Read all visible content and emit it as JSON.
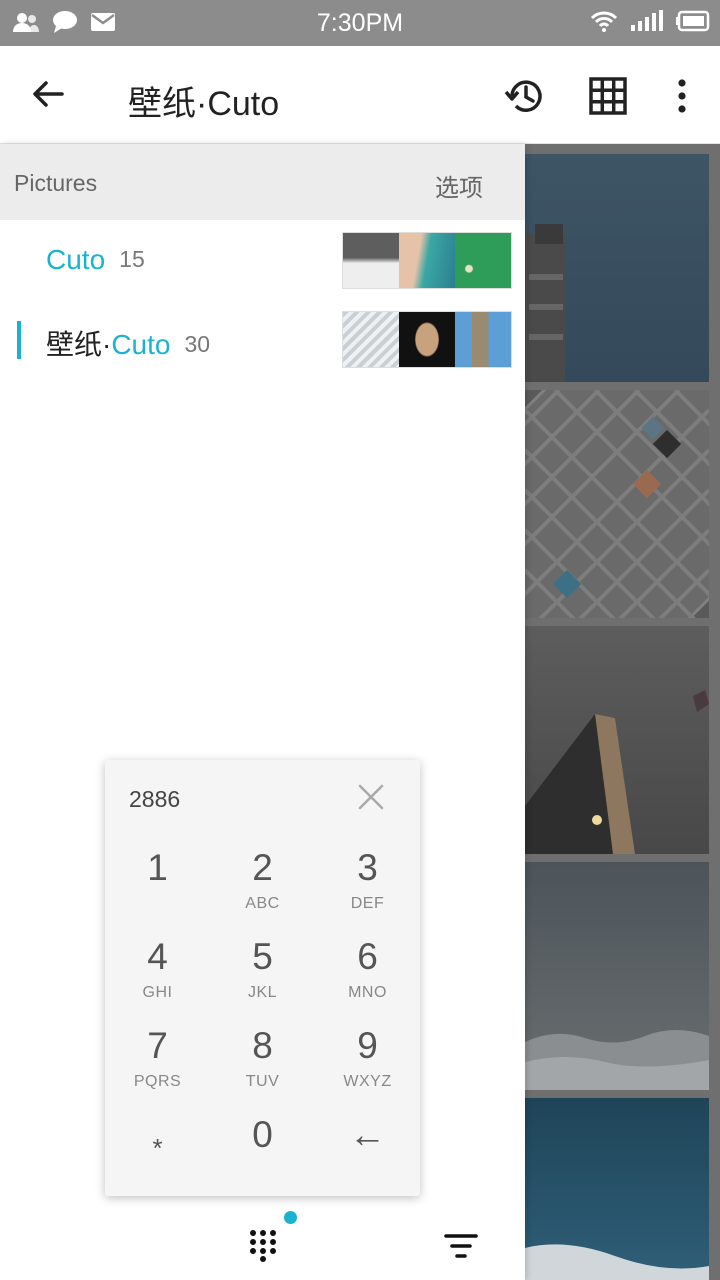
{
  "status_bar": {
    "time": "7:30PM",
    "left_icons": [
      "contacts-icon",
      "chat-bubble-icon",
      "mail-icon"
    ],
    "right_icons": [
      "wifi-icon",
      "signal-icon",
      "battery-icon"
    ]
  },
  "app_bar": {
    "title": "壁纸·Cuto",
    "back_icon": "arrow-back-icon",
    "actions": [
      "history-icon",
      "grid-view-icon",
      "more-vert-icon"
    ]
  },
  "drawer": {
    "header_left": "Pictures",
    "header_right": "选项",
    "folders": [
      {
        "name_cn": "",
        "name_cuto": "Cuto",
        "count": "15",
        "selected": false,
        "thumb_colors": [
          "#7a7a7a",
          "#3aa8a5",
          "#2e9d5a"
        ]
      },
      {
        "name_cn": "壁纸·",
        "name_cuto": "Cuto",
        "count": "30",
        "selected": true,
        "thumb_colors": [
          "#d8dde0",
          "#141414",
          "#5b9fd6"
        ]
      }
    ]
  },
  "dialpad": {
    "entry": "2886",
    "clear_icon": "close-icon",
    "keys": [
      {
        "num": "1",
        "letters": ""
      },
      {
        "num": "2",
        "letters": "ABC"
      },
      {
        "num": "3",
        "letters": "DEF"
      },
      {
        "num": "4",
        "letters": "GHI"
      },
      {
        "num": "5",
        "letters": "JKL"
      },
      {
        "num": "6",
        "letters": "MNO"
      },
      {
        "num": "7",
        "letters": "PQRS"
      },
      {
        "num": "8",
        "letters": "TUV"
      },
      {
        "num": "9",
        "letters": "WXYZ"
      },
      {
        "num": "*",
        "letters": ""
      },
      {
        "num": "0",
        "letters": ""
      },
      {
        "num": "←",
        "letters": ""
      }
    ]
  },
  "bottom_bar": {
    "left_icon": "dialpad-icon",
    "right_icon": "filter-icon"
  },
  "colors": {
    "accent": "#1ab3cf",
    "status_bar": "#8c8c8c",
    "drawer_header": "#ececec"
  }
}
